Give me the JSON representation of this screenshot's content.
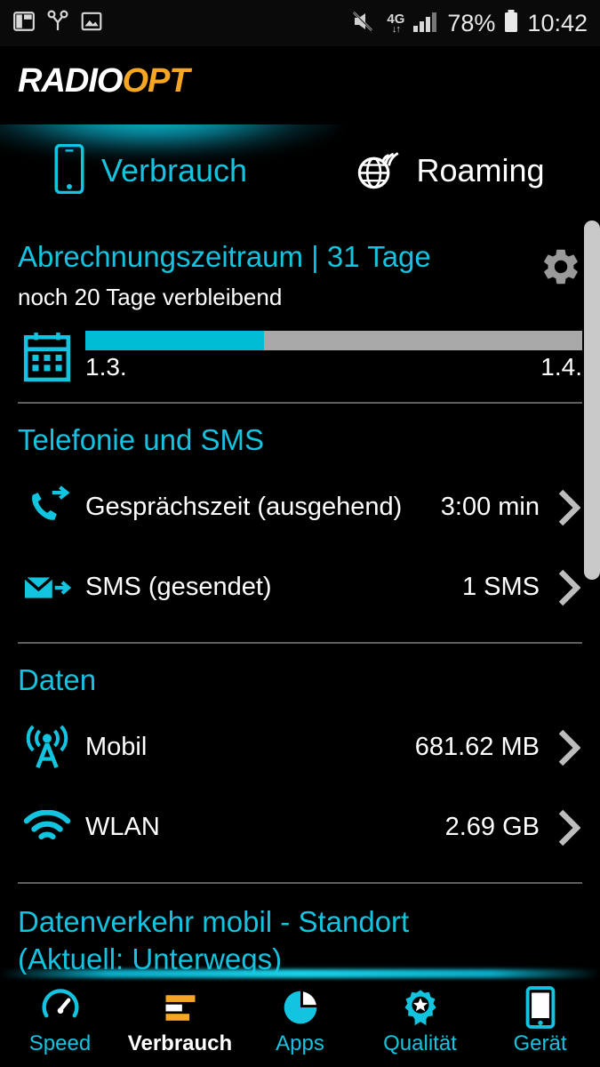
{
  "statusbar": {
    "left_icons": [
      "multi-window-icon",
      "share-y-icon",
      "image-icon"
    ],
    "mute_icon": "mute-icon",
    "network_type": "4G",
    "network_arrows": "↓↑",
    "signal_icon": "signal-bars-icon",
    "battery_percent": "78%",
    "battery_icon": "battery-icon",
    "time": "10:42"
  },
  "brand": {
    "name_part1": "RADIO",
    "name_part2": "OPT",
    "accent_color": "#f5a623",
    "cyan_color": "#13c4e0"
  },
  "tabs": [
    {
      "label": "Verbrauch",
      "icon": "smartphone-icon",
      "active": true
    },
    {
      "label": "Roaming",
      "icon": "globe-signal-icon",
      "active": false
    }
  ],
  "billing": {
    "title": "Abrechnungszeitraum | 31 Tage",
    "subtitle": "noch 20 Tage verbleibend",
    "settings_icon": "gear-icon",
    "calendar_icon": "calendar-icon",
    "progress_percent": 36,
    "start_date": "1.3.",
    "end_date": "1.4."
  },
  "telephony": {
    "title": "Telefonie und SMS",
    "rows": [
      {
        "icon": "outgoing-call-icon",
        "label": "Gesprächszeit (ausgehend)",
        "value": "3:00 min"
      },
      {
        "icon": "sent-sms-icon",
        "label": "SMS (gesendet)",
        "value": "1 SMS"
      }
    ]
  },
  "data": {
    "title": "Daten",
    "rows": [
      {
        "icon": "cell-tower-icon",
        "label": "Mobil",
        "value": "681.62 MB"
      },
      {
        "icon": "wifi-icon",
        "label": "WLAN",
        "value": "2.69 GB"
      }
    ]
  },
  "traffic": {
    "title_line1": "Datenverkehr mobil - Standort",
    "title_line2": "(Aktuell: Unterwegs)"
  },
  "navbar": [
    {
      "label": "Speed",
      "icon": "speedometer-icon",
      "active": false
    },
    {
      "label": "Verbrauch",
      "icon": "bar-list-icon",
      "active": true
    },
    {
      "label": "Apps",
      "icon": "pie-chart-icon",
      "active": false
    },
    {
      "label": "Qualität",
      "icon": "award-star-icon",
      "active": false
    },
    {
      "label": "Gerät",
      "icon": "device-phone-icon",
      "active": false
    }
  ]
}
